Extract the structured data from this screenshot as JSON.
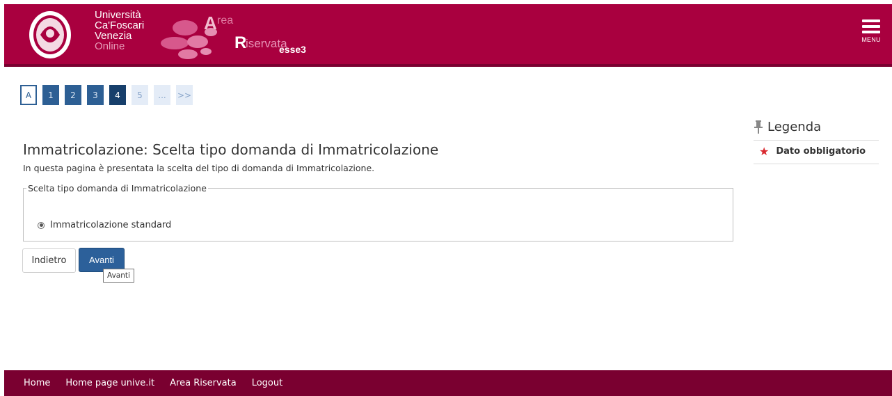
{
  "header": {
    "university_lines": [
      "Università",
      "Ca'Foscari",
      "Venezia"
    ],
    "online": "Online",
    "area_a": "A",
    "area_rea": "rea",
    "area_r": "R",
    "area_iservata": "iservata",
    "area_esse3": "esse3",
    "menu_label": "MENU",
    "brand_color": "#a9003f"
  },
  "stepper": {
    "a_label": "A",
    "steps": [
      "1",
      "2",
      "3",
      "4",
      "5",
      "...",
      ">>"
    ]
  },
  "main": {
    "title": "Immatricolazione: Scelta tipo domanda di Immatricolazione",
    "intro": "In questa pagina è presentata la scelta del tipo di domanda di Immatricolazione.",
    "fieldset_legend": "Scelta tipo domanda di Immatricolazione",
    "option_label": "Immatricolazione standard",
    "option_selected": true
  },
  "actions": {
    "back_label": "Indietro",
    "next_label": "Avanti",
    "tooltip": "Avanti"
  },
  "legend": {
    "title": "Legenda",
    "required_label": "Dato obbligatorio",
    "pin_icon": "pin-icon",
    "star_icon": "asterisk-icon"
  },
  "footer": {
    "links": [
      "Home",
      "Home page unive.it",
      "Area Riservata",
      "Logout"
    ]
  }
}
